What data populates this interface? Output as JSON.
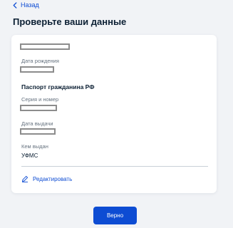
{
  "nav": {
    "back_label": "Назад"
  },
  "page": {
    "title": "Проверьте ваши данные"
  },
  "card": {
    "birth_date_label": "Дата рождения",
    "passport_section_title": "Паспорт гражданина РФ",
    "series_number_label": "Серия и номер",
    "issue_date_label": "Дата выдачи",
    "issued_by_label": "Кем выдан",
    "issued_by_value": "УФМС",
    "edit_label": "Редактировать",
    "edit_icon": "pencil-icon"
  },
  "actions": {
    "confirm_label": "Верно"
  },
  "colors": {
    "accent": "#0d4cd3",
    "background": "#f1f3f6",
    "text": "#0b1f33",
    "muted": "#66727f"
  }
}
